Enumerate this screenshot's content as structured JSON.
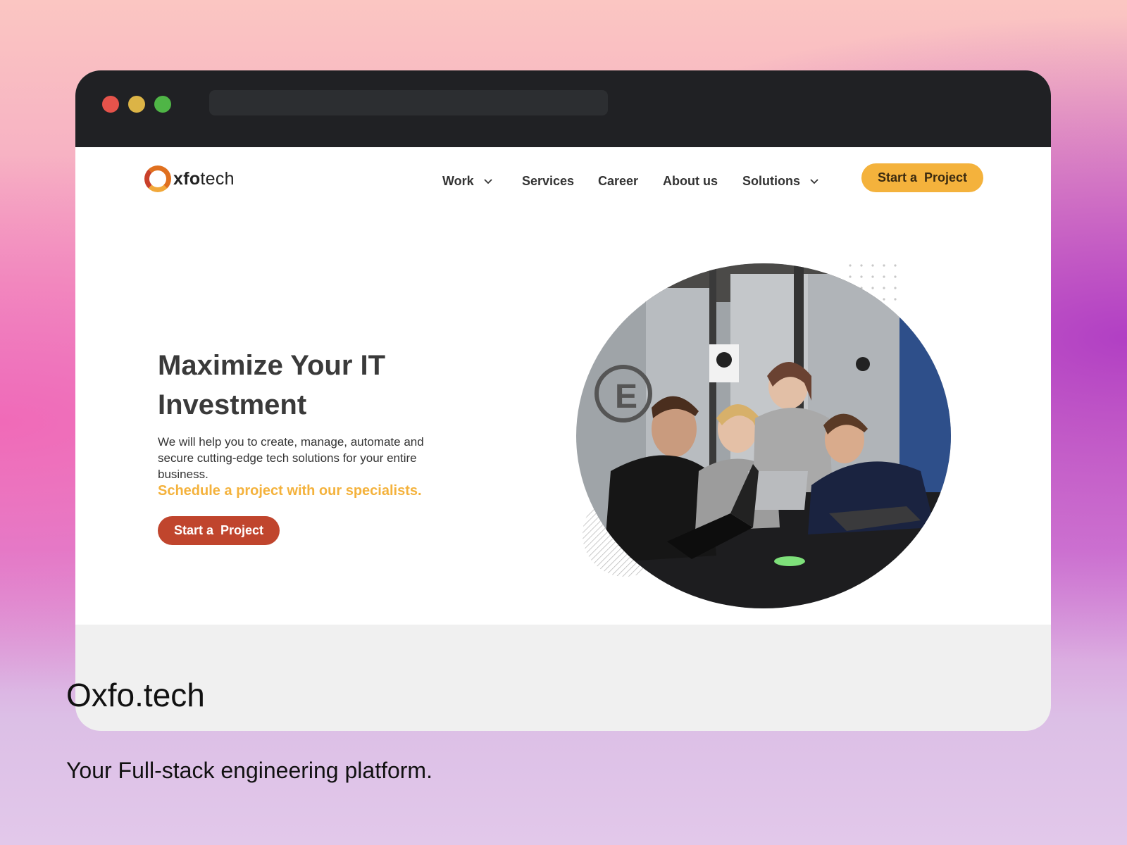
{
  "browser": {
    "traffic_lights": [
      "#e5534b",
      "#dcb446",
      "#4fb546"
    ],
    "url": ""
  },
  "site": {
    "logo": {
      "prefix": "xfo",
      "suffix": "tech",
      "ring_color": "#e0701f"
    },
    "nav": {
      "items": [
        {
          "label": "Work",
          "has_dropdown": true
        },
        {
          "label": "Services",
          "has_dropdown": false
        },
        {
          "label": "Career",
          "has_dropdown": false
        },
        {
          "label": "About us",
          "has_dropdown": false
        },
        {
          "label": "Solutions",
          "has_dropdown": true
        }
      ],
      "cta_label": "Start a  Project",
      "cta_color": "#f4b23c"
    },
    "hero": {
      "title": "Maximize Your IT Investment",
      "description": "We will help you to create, manage, automate and secure cutting-edge tech solutions for your entire business.",
      "highlight": "Schedule a project with our specialists.",
      "highlight_color": "#f4b23c",
      "button_label": "Start a  Project",
      "button_color": "#c0452d",
      "image": "team-working-at-laptops-photo"
    }
  },
  "caption": {
    "title": "Oxfo.tech",
    "subtitle": "Your Full-stack engineering platform."
  }
}
